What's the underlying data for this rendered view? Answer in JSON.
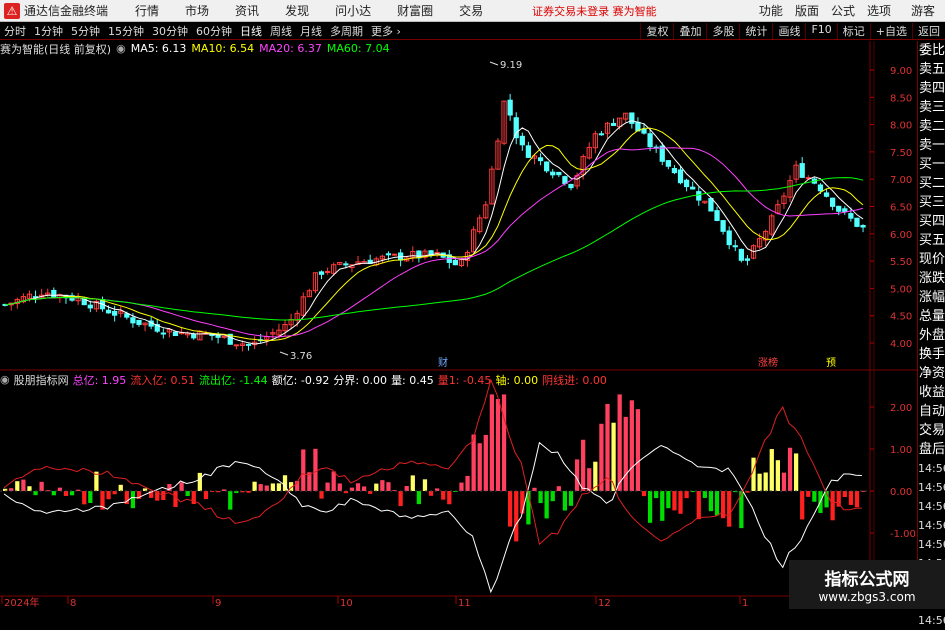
{
  "menubar": {
    "app_name": "通达信金融终端",
    "items": [
      "行情",
      "市场",
      "资讯",
      "发现",
      "问小达",
      "财富圈",
      "交易"
    ],
    "notice": "证券交易未登录",
    "notice_stock": "赛为智能",
    "right_items": [
      "功能",
      "版面",
      "公式",
      "选项"
    ],
    "guest": "游客"
  },
  "toolbar": {
    "periods": [
      "分时",
      "1分钟",
      "5分钟",
      "15分钟",
      "30分钟",
      "60分钟",
      "日线",
      "周线",
      "月线",
      "多周期",
      "更多"
    ],
    "active_period": "日线",
    "right_tabs": [
      "复权",
      "叠加",
      "多股",
      "统计",
      "画线",
      "F10",
      "标记",
      "+自选",
      "返回"
    ]
  },
  "main_chart": {
    "title": "赛为智能(日线 前复权)",
    "ma": [
      {
        "label": "MA5: 6.13",
        "color": "#ffffff"
      },
      {
        "label": "MA10: 6.54",
        "color": "#ffff00"
      },
      {
        "label": "MA20: 6.37",
        "color": "#ff40ff"
      },
      {
        "label": "MA60: 7.04",
        "color": "#00ff00"
      }
    ],
    "high_label": "9.19",
    "low_label": "3.76",
    "markers": [
      {
        "text": "财",
        "color": "#6fa8ff"
      },
      {
        "text": "涨榜",
        "color": "#ff4040"
      },
      {
        "text": "预",
        "color": "#ffff00"
      }
    ]
  },
  "indicator": {
    "name": "股朋指标网",
    "values": [
      {
        "label": "总亿: 1.95",
        "color": "#ff40ff"
      },
      {
        "label": "流入亿: 0.51",
        "color": "#ff3030"
      },
      {
        "label": "流出亿: -1.44",
        "color": "#00ff00"
      },
      {
        "label": "额亿: -0.92",
        "color": "#ffffff"
      },
      {
        "label": "分界: 0.00",
        "color": "#ffffff"
      },
      {
        "label": "量: 0.45",
        "color": "#ffffff"
      },
      {
        "label": "量1: -0.45",
        "color": "#ff3030"
      },
      {
        "label": "轴: 0.00",
        "color": "#ffff00"
      },
      {
        "label": "阴线进: 0.00",
        "color": "#ff3030"
      }
    ]
  },
  "sidepanel": {
    "items": [
      "委比",
      "卖五",
      "卖四",
      "卖三",
      "卖二",
      "卖一",
      "买一",
      "买二",
      "买三",
      "买四",
      "买五",
      "现价",
      "涨跌",
      "涨幅",
      "总量",
      "外盘",
      "换手",
      "净资",
      "收益",
      "自动",
      "交易",
      "盘后",
      "14:56",
      "14:56",
      "14:56",
      "14:56",
      "14:56",
      "14:56",
      "14:56",
      "14:56",
      "14:56"
    ]
  },
  "axes": {
    "main": {
      "ticks": [
        "9.00",
        "8.50",
        "8.00",
        "7.50",
        "7.00",
        "6.50",
        "6.00",
        "5.50",
        "5.00",
        "4.50",
        "4.00"
      ]
    },
    "indicator": {
      "ticks": [
        "2.00",
        "1.00",
        "0.00",
        "-1.00"
      ]
    },
    "dates": [
      "2024年",
      "8",
      "9",
      "10",
      "11",
      "12",
      "1"
    ]
  },
  "watermark": {
    "line1": "指标公式网",
    "line2": "www.zbgs3.com"
  }
}
